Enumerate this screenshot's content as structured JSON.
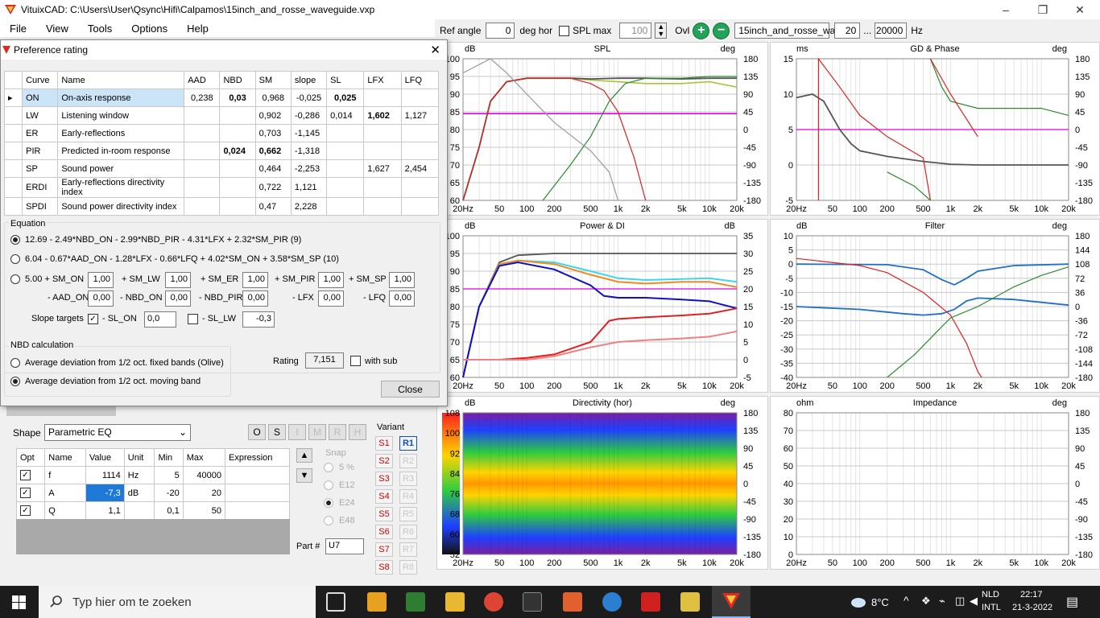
{
  "window": {
    "title": "VituixCAD: C:\\Users\\User\\Qsync\\Hifi\\Calpamos\\15inch_and_rosse_waveguide.vxp",
    "minimize": "–",
    "maximize": "❐",
    "close": "✕"
  },
  "menu": [
    "File",
    "View",
    "Tools",
    "Options",
    "Help"
  ],
  "toolbar": {
    "ref_angle_label": "Ref angle",
    "ref_angle": "0",
    "deg_hor": "deg hor",
    "spl_max_label": "SPL max",
    "spl_max": "100",
    "ovl": "Ovl",
    "file_field": "15inch_and_rosse_wav",
    "freq_from": "20",
    "dots": "...",
    "freq_to": "20000",
    "hz": "Hz"
  },
  "graphs": {
    "spl": {
      "title": "SPL",
      "left_unit": "dB",
      "right_unit": "deg",
      "left_ticks": [
        "100",
        "95",
        "90",
        "85",
        "80",
        "75",
        "70",
        "65",
        "60"
      ],
      "right_ticks": [
        "180",
        "135",
        "90",
        "45",
        "0",
        "-45",
        "-90",
        "-135",
        "-180"
      ]
    },
    "gd": {
      "title": "GD & Phase",
      "left_unit": "ms",
      "right_unit": "deg",
      "left_ticks": [
        "15",
        "10",
        "5",
        "0",
        "-5"
      ],
      "right_ticks": [
        "180",
        "135",
        "90",
        "45",
        "0",
        "-45",
        "-90",
        "-135",
        "-180"
      ]
    },
    "power": {
      "title": "Power & DI",
      "left_unit": "dB",
      "right_unit": "dB",
      "left_ticks": [
        "100",
        "95",
        "90",
        "85",
        "80",
        "75",
        "70",
        "65",
        "60"
      ],
      "right_ticks": [
        "35",
        "30",
        "25",
        "20",
        "15",
        "10",
        "5",
        "0",
        "-5"
      ]
    },
    "filter": {
      "title": "Filter",
      "left_unit": "dB",
      "right_unit": "deg",
      "left_ticks": [
        "10",
        "5",
        "0",
        "-5",
        "-10",
        "-15",
        "-20",
        "-25",
        "-30",
        "-35",
        "-40"
      ],
      "right_ticks": [
        "180",
        "144",
        "108",
        "72",
        "36",
        "0",
        "-36",
        "-72",
        "-108",
        "-144",
        "-180"
      ]
    },
    "directivity": {
      "title": "Directivity (hor)",
      "left_unit": "dB",
      "right_unit": "deg",
      "left_ticks": [
        "108",
        "100",
        "92",
        "84",
        "76",
        "68",
        "60",
        "52"
      ],
      "right_ticks": [
        "180",
        "135",
        "90",
        "45",
        "0",
        "-45",
        "-90",
        "-135",
        "-180"
      ]
    },
    "impedance": {
      "title": "Impedance",
      "left_unit": "ohm",
      "right_unit": "deg",
      "left_ticks": [
        "80",
        "70",
        "60",
        "50",
        "40",
        "30",
        "20",
        "10",
        "0"
      ],
      "right_ticks": [
        "180",
        "135",
        "90",
        "45",
        "0",
        "-45",
        "-90",
        "-135",
        "-180"
      ]
    },
    "x_ticks": [
      "20Hz",
      "50",
      "100",
      "200",
      "500",
      "1k",
      "2k",
      "5k",
      "10k",
      "20k"
    ]
  },
  "dialog": {
    "title": "Preference rating",
    "close": "✕",
    "headers": [
      "Curve",
      "Name",
      "AAD",
      "NBD",
      "SM",
      "slope",
      "SL",
      "LFX",
      "LFQ"
    ],
    "rows": [
      [
        "ON",
        "On-axis response",
        "0,238",
        "0,03",
        "0,968",
        "-0,025",
        "0,025",
        "",
        ""
      ],
      [
        "LW",
        "Listening window",
        "",
        "",
        "0,902",
        "-0,286",
        "0,014",
        "1,602",
        "1,127"
      ],
      [
        "ER",
        "Early-reflections",
        "",
        "",
        "0,703",
        "-1,145",
        "",
        "",
        ""
      ],
      [
        "PIR",
        "Predicted in-room response",
        "",
        "0,024",
        "0,662",
        "-1,318",
        "",
        "",
        ""
      ],
      [
        "SP",
        "Sound power",
        "",
        "",
        "0,464",
        "-2,253",
        "",
        "1,627",
        "2,454"
      ],
      [
        "ERDI",
        "Early-reflections directivity index",
        "",
        "",
        "0,722",
        "1,121",
        "",
        "",
        ""
      ],
      [
        "SPDI",
        "Sound power directivity index",
        "",
        "",
        "0,47",
        "2,228",
        "",
        "",
        ""
      ]
    ],
    "equation_legend": "Equation",
    "eq1": "12.69 - 2.49*NBD_ON - 2.99*NBD_PIR - 4.31*LFX + 2.32*SM_PIR (9)",
    "eq2": "6.04 - 0.67*AAD_ON - 1.28*LFX - 0.66*LFQ + 4.02*SM_ON + 3.58*SM_SP (10)",
    "eq3": {
      "prefix": "5.00 + SM_ON",
      "sm_lw": "+ SM_LW",
      "sm_er": "+ SM_ER",
      "sm_pir": "+ SM_PIR",
      "sm_sp": "+ SM_SP",
      "aad_on": "- AAD_ON",
      "nbd_on": "- NBD_ON",
      "nbd_pir": "- NBD_PIR",
      "lfx": "- LFX",
      "lfq": "- LFQ",
      "v_sm_on": "1,00",
      "v_sm_lw": "1,00",
      "v_sm_er": "1,00",
      "v_sm_pir": "1,00",
      "v_sm_sp": "1,00",
      "v_aad_on": "0,00",
      "v_nbd_on": "0,00",
      "v_nbd_pir": "0,00",
      "v_lfx": "0,00",
      "v_lfq": "0,00"
    },
    "slope_targets": "Slope targets",
    "sl_on": "- SL_ON",
    "sl_on_val": "0,0",
    "sl_lw": "- SL_LW",
    "sl_lw_val": "-0,3",
    "nbd_legend": "NBD calculation",
    "nbd1": "Average deviation from 1/2 oct. fixed bands (Olive)",
    "nbd2": "Average deviation from 1/2 oct. moving band",
    "rating_label": "Rating",
    "rating": "7,151",
    "with_sub": "with sub",
    "close_btn": "Close"
  },
  "eq_panel": {
    "shape_label": "Shape",
    "shape": "Parametric EQ",
    "btns": [
      "O",
      "S",
      "I",
      "M",
      "R",
      "H"
    ],
    "headers": [
      "Opt",
      "Name",
      "Value",
      "Unit",
      "Min",
      "Max",
      "Expression"
    ],
    "rows": [
      [
        "f",
        "1114",
        "Hz",
        "5",
        "40000"
      ],
      [
        "A",
        "-7,3",
        "dB",
        "-20",
        "20"
      ],
      [
        "Q",
        "1,1",
        "",
        "0,1",
        "50"
      ]
    ],
    "snap_label": "Snap",
    "snap": [
      "5 %",
      "E12",
      "E24",
      "E48"
    ],
    "part_label": "Part #",
    "part": "U7",
    "variant_label": "Variant",
    "variants_s": [
      "S1",
      "S2",
      "S3",
      "S4",
      "S5",
      "S6",
      "S7",
      "S8"
    ],
    "variants_r": [
      "R1",
      "R2",
      "R3",
      "R4",
      "R5",
      "R6",
      "R7",
      "R8"
    ]
  },
  "taskbar": {
    "search": "Typ hier om te zoeken",
    "temp": "8°C",
    "lang1": "NLD",
    "lang2": "INTL",
    "time": "22:17",
    "date": "21-3-2022"
  },
  "colors": {
    "magenta": "#e000e0",
    "olive": "#a4c639",
    "dark": "#555555",
    "red": "#e02020",
    "green": "#2a8a2a",
    "blue": "#1e6fc8",
    "cyan": "#3ad8ea",
    "orange": "#f08a20",
    "navy": "#1010c0"
  }
}
